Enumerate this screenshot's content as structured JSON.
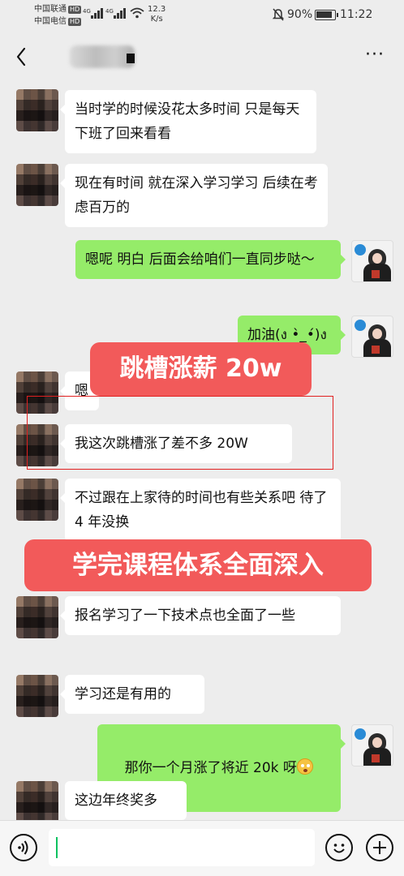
{
  "status_bar": {
    "carrier_1": "中国联通",
    "carrier_2": "中国电信",
    "hd": "HD",
    "network": "4G",
    "speed_value": "12.3",
    "speed_unit": "K/s",
    "battery": "90%",
    "time": "11:22"
  },
  "title_bar": {
    "back_icon": "chevron-left-icon",
    "more_label": "···"
  },
  "messages": [
    {
      "side": "in",
      "text": "当时学的时候没花太多时间 只是每天下班了回来看看"
    },
    {
      "side": "in",
      "text": "现在有时间 就在深入学习学习 后续在考虑百万的"
    },
    {
      "side": "out",
      "text": "嗯呢 明白 后面会给咱们一直同步哒～"
    },
    {
      "side": "out",
      "text": "加油(ง •̀_•́)ง"
    },
    {
      "side": "in",
      "text": "嗯"
    },
    {
      "side": "in",
      "text": "我这次跳槽涨了差不多 20W"
    },
    {
      "side": "in",
      "text": "不过跟在上家待的时间也有些关系吧 待了 4 年没换"
    },
    {
      "side": "in",
      "text": "报名学习了一下技术点也全面了一些"
    },
    {
      "side": "in",
      "text": "学习还是有用的"
    },
    {
      "side": "out",
      "text": "那你一个月涨了将近 20k 呀"
    },
    {
      "side": "in",
      "text": "这边年终奖多"
    }
  ],
  "banners": {
    "top": "跳槽涨薪 20w",
    "middle": "学完课程体系全面深入"
  },
  "colors": {
    "incoming_bubble": "#ffffff",
    "outgoing_bubble": "#95ec69",
    "banner": "#f25a5a",
    "highlight": "#e02020",
    "background": "#ededed"
  },
  "input_bar": {
    "voice_icon": "voice-icon",
    "emoji_icon": "emoji-icon",
    "plus_icon": "plus-icon",
    "value": ""
  }
}
